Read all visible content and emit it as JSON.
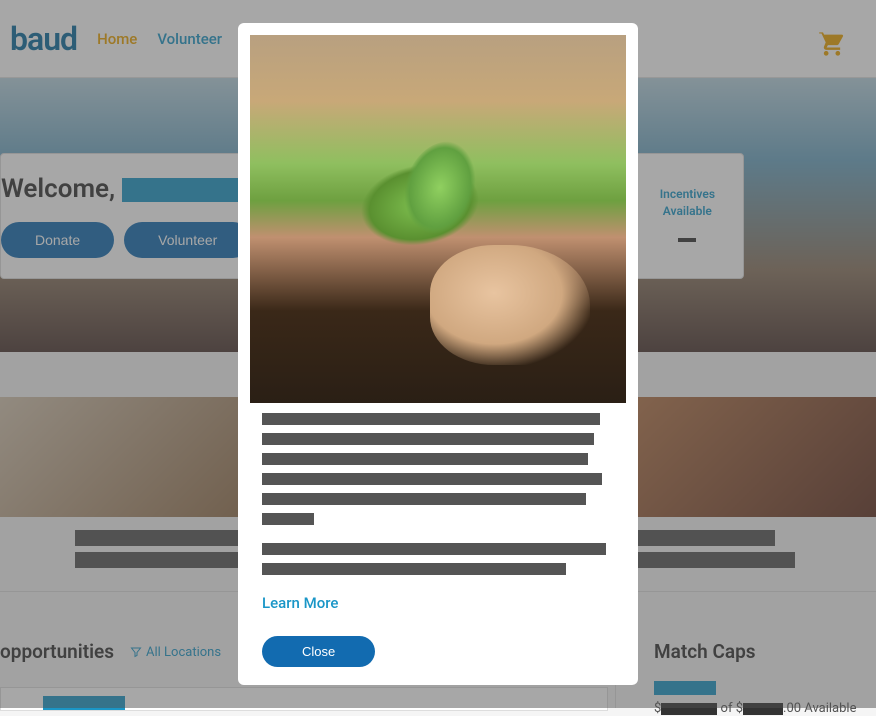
{
  "nav": {
    "logo": "baud",
    "links": [
      {
        "label": "Home",
        "active": true
      },
      {
        "label": "Volunteer",
        "active": false
      }
    ]
  },
  "welcome": {
    "prefix": "Welcome, ",
    "buttons": {
      "donate": "Donate",
      "volunteer": "Volunteer"
    },
    "incentives": {
      "line1": "Incentives",
      "line2": "Available"
    }
  },
  "opportunities": {
    "title": "opportunities",
    "filter": "All Locations"
  },
  "matchcaps": {
    "title": "Match Caps",
    "available_prefix": "$",
    "available_mid": " of $",
    "available_suffix": ".00 Available"
  },
  "modal": {
    "learn_more": "Learn More",
    "close": "Close"
  },
  "colors": {
    "accent": "#1a96c7",
    "button": "#126bb0",
    "highlight": "#eba300"
  }
}
